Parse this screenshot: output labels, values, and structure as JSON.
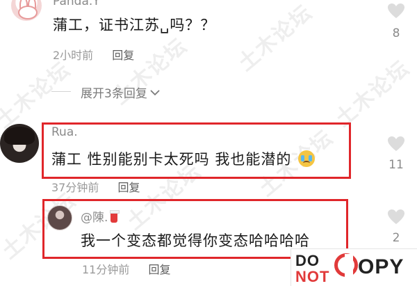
{
  "watermark": "土木论坛",
  "comments": [
    {
      "username": "Panda.Y",
      "text": "蒲工，证书江苏␣吗？？",
      "time": "2小时前",
      "reply_label": "回复",
      "likes": "8",
      "expand_replies": "展开3条回复"
    },
    {
      "username": "Rua.",
      "text": "蒲工 性别能别卡太死吗 我也能潜的",
      "time": "37分钟前",
      "reply_label": "回复",
      "likes": "11"
    },
    {
      "username": "@陳.",
      "text": "我一个变态都觉得你变态哈哈哈哈",
      "time": "11分钟前",
      "reply_label": "回复",
      "likes": "2"
    }
  ],
  "badge": {
    "do": "DO",
    "not": "NOT",
    "copy": "OPY"
  },
  "colors": {
    "highlight_box": "#e0262a",
    "badge_red": "#e13a3a"
  }
}
